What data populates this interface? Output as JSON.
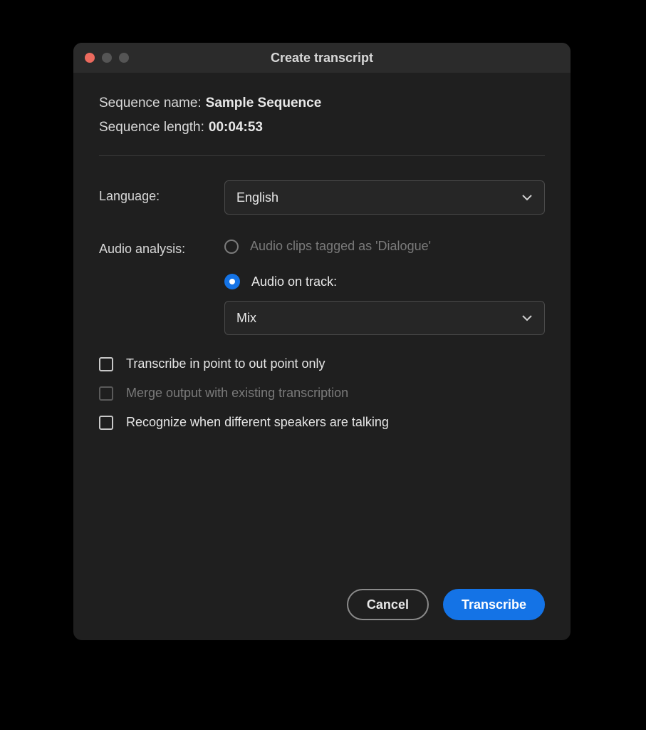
{
  "window": {
    "title": "Create transcript"
  },
  "info": {
    "seq_name_label": "Sequence name:",
    "seq_name_value": "Sample Sequence",
    "seq_len_label": "Sequence length:",
    "seq_len_value": "00:04:53"
  },
  "form": {
    "language_label": "Language:",
    "language_value": "English",
    "audio_analysis_label": "Audio analysis:",
    "radio_dialogue": "Audio clips tagged as 'Dialogue'",
    "radio_track": "Audio on track:",
    "track_value": "Mix"
  },
  "checkboxes": {
    "in_out": "Transcribe in point to out point only",
    "merge": "Merge output with existing transcription",
    "speakers": "Recognize when different speakers are talking"
  },
  "buttons": {
    "cancel": "Cancel",
    "transcribe": "Transcribe"
  }
}
